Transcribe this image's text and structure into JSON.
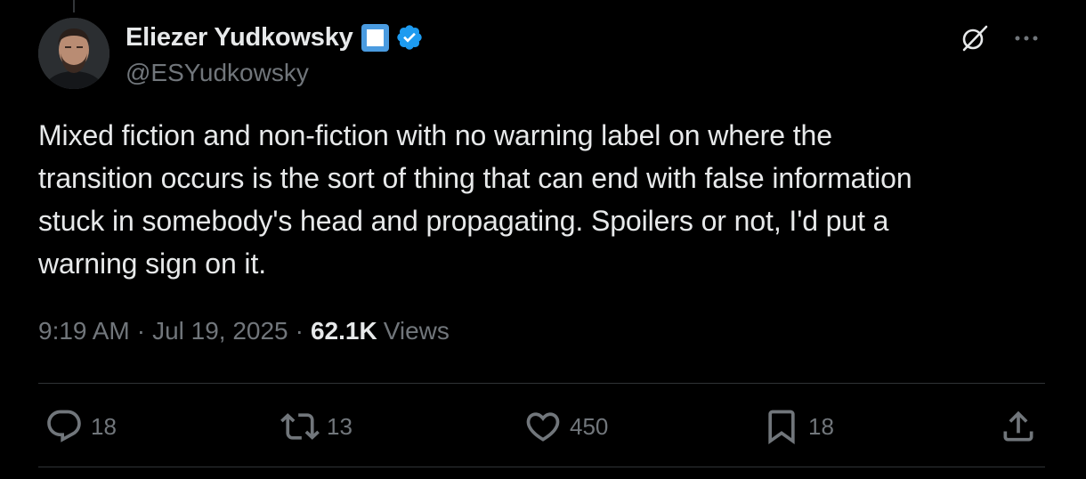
{
  "tweet": {
    "author": {
      "display_name": "Eliezer Yudkowsky",
      "handle": "@ESYudkowsky"
    },
    "text": "Mixed fiction and non-fiction with no warning label on where the\ntransition occurs is the sort of thing that can end with false information\nstuck in somebody's head and propagating. Spoilers or not, I'd put a\nwarning sign on it.",
    "time": "9:19 AM",
    "separator": "·",
    "date": "Jul 19, 2025",
    "views_count": "62.1K",
    "views_label": "Views"
  },
  "actions": {
    "replies": "18",
    "reposts": "13",
    "likes": "450",
    "bookmarks": "18"
  },
  "icons": {
    "square_badge": "blue-square-icon",
    "verified": "verified-badge-icon",
    "grok": "grok-icon",
    "more": "more-icon",
    "reply": "reply-icon",
    "repost": "repost-icon",
    "like": "heart-icon",
    "bookmark": "bookmark-icon",
    "share": "share-icon"
  },
  "colors": {
    "background": "#000000",
    "text_primary": "#e7e9ea",
    "text_secondary": "#71767b",
    "verified_blue": "#1d9bf0",
    "divider": "#2f3336"
  }
}
